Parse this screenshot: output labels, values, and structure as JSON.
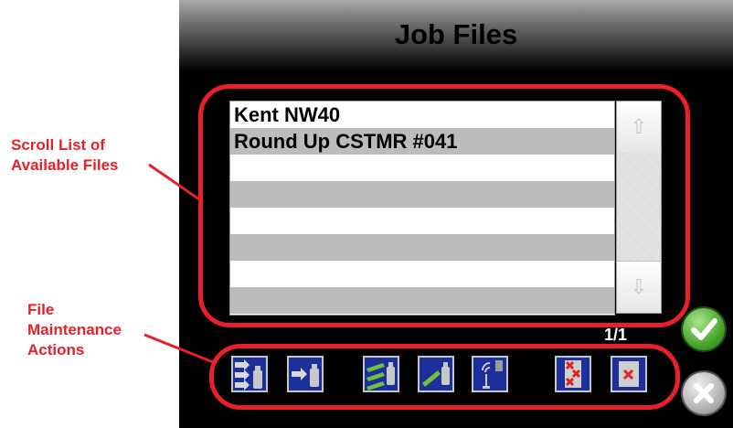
{
  "title": "Job Files",
  "files": [
    "Kent NW40",
    "Round Up CSTMR #041",
    "",
    "",
    "",
    "",
    "",
    ""
  ],
  "scroll": {
    "up_icon": "arrow-up-icon",
    "down_icon": "arrow-down-icon"
  },
  "page_indicator": "1/1",
  "actions": [
    {
      "name": "import-all-files",
      "icon": "multi-arrow-to-usb-icon"
    },
    {
      "name": "import-file",
      "icon": "arrow-to-usb-icon"
    },
    {
      "name": "export-all-files",
      "icon": "multi-export-green-icon"
    },
    {
      "name": "export-file",
      "icon": "export-green-icon"
    },
    {
      "name": "transfer-file",
      "icon": "wireless-antenna-icon"
    },
    {
      "name": "delete-all-files",
      "icon": "delete-all-icon"
    },
    {
      "name": "delete-file",
      "icon": "delete-file-icon"
    }
  ],
  "annotations": {
    "scroll_list": "Scroll List of Available Files",
    "file_maintenance": "File Maintenance Actions"
  },
  "colors": {
    "highlight": "#e8202a",
    "accept": "#48a32c",
    "action_bg": "#1c2f9a"
  }
}
